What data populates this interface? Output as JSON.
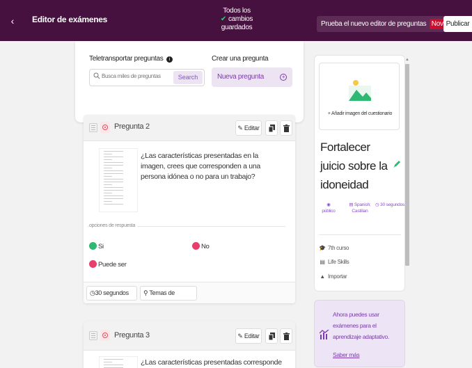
{
  "header": {
    "back_icon": "chevron-left-icon",
    "title": "Editor de exámenes",
    "saved_line1": "Todos los",
    "saved_line2": "cambios",
    "saved_line3": "guardados",
    "try_new_editor": "Prueba el nuevo editor de preguntas",
    "new_badge": "Novedad",
    "publish": "Publicar"
  },
  "teleport": {
    "label": "Teletransportar preguntas",
    "search_placeholder": "Busca miles de preguntas",
    "search_button": "Search"
  },
  "create": {
    "label": "Crear una pregunta",
    "button": "Nueva pregunta"
  },
  "questions": [
    {
      "number": "Pregunta 2",
      "edit": "Editar",
      "text": "¿Las características presentadas en la imagen, crees que corresponden a una persona idónea o no para un trabajo?",
      "options_label": "opciones de respuesta",
      "options": [
        {
          "label": "Si",
          "color": "#2eb872"
        },
        {
          "label": "No",
          "color": "#e83e6c"
        },
        {
          "label": "Puede ser",
          "color": "#e83e6c"
        }
      ],
      "time": "30 segundos",
      "tags": "Temas de etiqueta"
    },
    {
      "number": "Pregunta 3",
      "edit": "Editar",
      "text": "¿Las características presentadas corresponde a una"
    }
  ],
  "quiz": {
    "add_image": "+ Añadir imagen del cuestionario",
    "title": "Fortalecer juicio sobre la idoneidad",
    "visibility": "público",
    "language": "Spanish; Castilian",
    "duration": "30 segundos",
    "grade": "7th curso",
    "subject": "Life Skills",
    "import": "Importar"
  },
  "promo": {
    "text": "Ahora puedes usar exámenes para el aprendizaje adaptativo.",
    "link": "Saber más"
  },
  "colors": {
    "header_bg": "#46103f",
    "accent_purple": "#8854c0",
    "badge_red": "#c8102e"
  }
}
